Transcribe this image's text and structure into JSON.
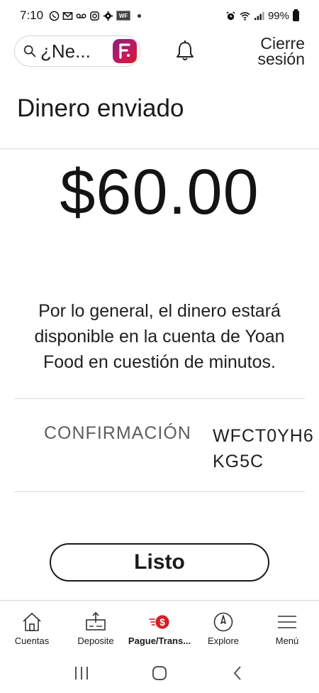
{
  "status_bar": {
    "time": "7:10",
    "wf_badge": "WF",
    "battery": "99%",
    "icons": [
      "whatsapp-icon",
      "gmail-icon",
      "voicemail-icon",
      "instagram-icon",
      "settings-gear-icon",
      "alarm-icon",
      "wifi-icon",
      "signal-icon",
      "battery-icon"
    ]
  },
  "header": {
    "search_text": "¿Ne...",
    "signout_line1": "Cierre",
    "signout_line2": "sesión"
  },
  "page": {
    "title": "Dinero enviado",
    "amount": "$60.00",
    "message": "Por lo general, el dinero estará disponible en la cuenta de Yoan Food en cuestión de minutos.",
    "confirmation_label": "CONFIRMACIÓN",
    "confirmation_value": "WFCT0YH6KG5C",
    "done_label": "Listo"
  },
  "bottom_nav": [
    {
      "label": "Cuentas",
      "icon": "home-icon"
    },
    {
      "label": "Deposite",
      "icon": "deposit-icon"
    },
    {
      "label": "Pague/Trans...",
      "icon": "pay-transfer-icon",
      "active": true
    },
    {
      "label": "Explore",
      "icon": "compass-icon"
    },
    {
      "label": "Menú",
      "icon": "menu-icon"
    }
  ],
  "colors": {
    "brand_red": "#d71e28",
    "fargo_gradient_start": "#8a1f7e",
    "divider": "#d9d9d9"
  }
}
